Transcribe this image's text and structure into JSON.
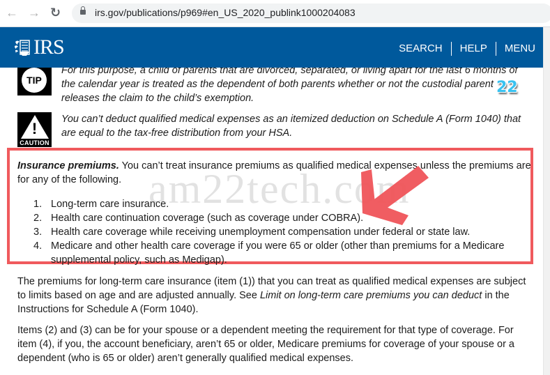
{
  "browser": {
    "url": "irs.gov/publications/p969#en_US_2020_publink1000204083",
    "back_icon": "arrow-left-icon",
    "forward_icon": "arrow-right-icon",
    "reload_icon": "reload-icon",
    "lock_icon": "lock-icon"
  },
  "header": {
    "logo_text": "IRS",
    "logo_icon": "irs-eagle-icon",
    "nav": [
      {
        "label": "SEARCH"
      },
      {
        "label": "HELP"
      },
      {
        "label": "MENU"
      }
    ],
    "background_color": "#00599c"
  },
  "notes": {
    "tip": {
      "icon_label": "TIP",
      "text": "For this purpose, a child of parents that are divorced, separated, or living apart for the last 6 months of the calendar year is treated as the dependent of both parents whether or not the custodial parent releases the claim to the child’s exemption."
    },
    "caution": {
      "icon_label": "CAUTION",
      "text": "You can’t deduct qualified medical expenses as an itemized deduction on Schedule A (Form 1040) that are equal to the tax-free distribution from your HSA."
    }
  },
  "insurance": {
    "heading": "Insurance premiums.",
    "intro": " You can’t treat insurance premiums as qualified medical expenses unless the premiums are for any of the following.",
    "items": [
      {
        "num": "1.",
        "text": "Long-term care insurance."
      },
      {
        "num": "2.",
        "text": "Health care continuation coverage (such as coverage under COBRA)."
      },
      {
        "num": "3.",
        "text": "Health care coverage while receiving unemployment compensation under federal or state law."
      },
      {
        "num": "4.",
        "text": "Medicare and other health care coverage if you were 65 or older (other than premiums for a Medicare supplemental policy, such as Medigap)."
      }
    ]
  },
  "paragraphs": {
    "ltc_before": "The premiums for long-term care insurance (item (1)) that you can treat as qualified medical expenses are subject to limits based on age and are adjusted annually. See ",
    "ltc_link": "Limit on long-term care premiums you can deduct",
    "ltc_after": " in the Instructions for Schedule A (Form 1040).",
    "items_text": "Items (2) and (3) can be for your spouse or a dependent meeting the requirement for that type of coverage. For item (4), if you, the account beneficiary, aren’t 65 or older, Medicare premiums for coverage of your spouse or a dependent (who is 65 or older) aren’t generally qualified medical expenses."
  },
  "overlay": {
    "watermark": "am22tech.com",
    "badge": "22",
    "highlight_color": "#f05a5d"
  }
}
